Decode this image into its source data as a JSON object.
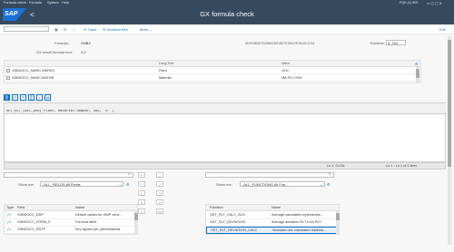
{
  "menu": {
    "items": [
      "Formula check",
      "Formula",
      "System",
      "Help"
    ],
    "session": "FQ0 (1) 800"
  },
  "window": {
    "title": "GX formula check",
    "back": "<"
  },
  "toolbar": {
    "dropdown": "",
    "trace": "Trace",
    "decision_tree": "Decision tree",
    "more": "More",
    "exit": "Exit"
  },
  "form": {
    "formula_label": "Formula:",
    "formula_value": "ZMB2",
    "guid_value": "0D90B6E7D3B81EE4B7E39A7E9A9CC04",
    "runtime_label": "Runtime:",
    "runtime_value": "4, 234",
    "result_label": "GX result formula text:",
    "result_value": "2,2"
  },
  "params_table": {
    "headers": [
      "Long Text",
      "Value"
    ],
    "rows": [
      {
        "name": "/GBIDOCC_MARC.WERKS",
        "long_text": "Plant",
        "value": "1010"
      },
      {
        "name": "/GBIDOCC_MARC.MATNR",
        "long_text": "Material",
        "value": "MA.FG.CV90"
      }
    ]
  },
  "editor": {
    "text": "GET_RLT_CALC_AVG( Plant, Material Number, 365, 'X' )",
    "status_pos": "Ln 1, Co 54",
    "status_lines": "Ln 1 - Ln 1 of 1 lines"
  },
  "fields": {
    "search": "",
    "show_label": "Show me:",
    "show_value": "..ALL_FIELDS All Fields",
    "headers": [
      "Type",
      "Field",
      "Name"
    ],
    "rows": [
      {
        "field": "/GBIDOCC_DDP",
        "name": "Default values for GMP versi..."
      },
      {
        "field": "/GBIDOCC_FORM_E",
        "name": "Formula attrib."
      },
      {
        "field": "/GBIDOCC_RSTP",
        "name": "Key figures per plant/material"
      }
    ]
  },
  "functions": {
    "search": "",
    "show_label": "Show me:",
    "show_value": "..ALL_FUNCTIONS All Fun...",
    "headers": [
      "Function",
      "Name"
    ],
    "rows": [
      {
        "function": "GET_RLT_CALC_AVG",
        "name": "Average calculated replenishme..."
      },
      {
        "function": "GET_RLT_DEVIATION",
        "name": "Average deviation RLT from RLT..."
      },
      {
        "function": "GET_RLT_DEVIATION_CALC",
        "name": "Standard dev. calculated replenis..."
      }
    ]
  },
  "operators": [
    "+",
    "-",
    "*",
    "/",
    "(",
    ")",
    "<",
    ">",
    "=",
    "<>"
  ],
  "colors": {
    "shell": "#354a5f",
    "accent": "#0a6ed1"
  }
}
